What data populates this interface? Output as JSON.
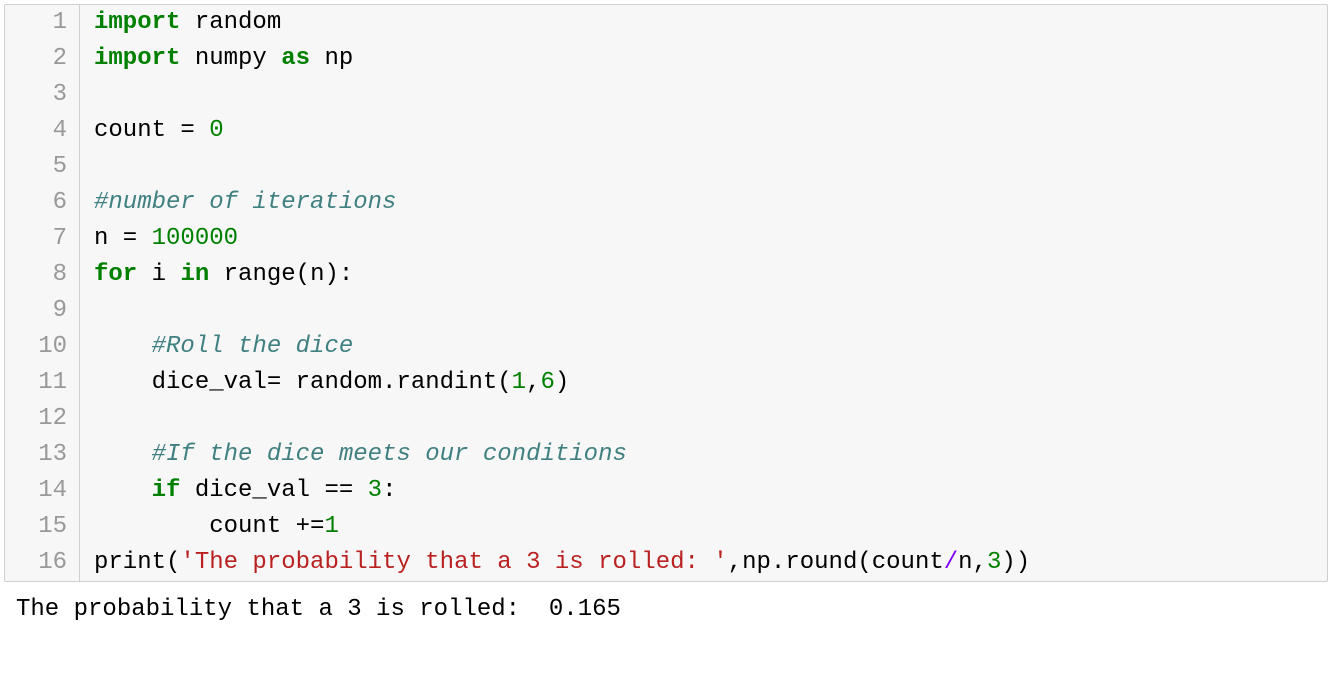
{
  "gutter": [
    "1",
    "2",
    "3",
    "4",
    "5",
    "6",
    "7",
    "8",
    "9",
    "10",
    "11",
    "12",
    "13",
    "14",
    "15",
    "16"
  ],
  "lines": {
    "l1": {
      "kw1": "import",
      "rest": " random"
    },
    "l2": {
      "kw1": "import",
      "mid": " numpy ",
      "kw2": "as",
      "rest": " np"
    },
    "l3": {
      "txt": ""
    },
    "l4": {
      "pre": "count = ",
      "num": "0"
    },
    "l5": {
      "txt": ""
    },
    "l6": {
      "cmt": "#number of iterations"
    },
    "l7": {
      "pre": "n = ",
      "num": "100000"
    },
    "l8": {
      "kw1": "for",
      "mid1": " i ",
      "kw2": "in",
      "mid2": " range(n):"
    },
    "l9": {
      "txt": ""
    },
    "l10": {
      "indent": "    ",
      "cmt": "#Roll the dice"
    },
    "l11": {
      "indent": "    ",
      "pre": "dice_val= random.randint(",
      "num1": "1",
      "comma": ",",
      "num2": "6",
      "end": ")"
    },
    "l12": {
      "txt": ""
    },
    "l13": {
      "indent": "    ",
      "cmt": "#If the dice meets our conditions"
    },
    "l14": {
      "indent": "    ",
      "kw1": "if",
      "mid": " dice_val == ",
      "num": "3",
      "end": ":"
    },
    "l15": {
      "indent": "        ",
      "pre": "count +=",
      "num": "1"
    },
    "l16": {
      "pre": "print(",
      "str": "'The probability that a 3 is rolled: '",
      "mid": ",np.round(count",
      "slash": "/",
      "post": "n,",
      "num": "3",
      "end": "))"
    }
  },
  "output": "The probability that a 3 is rolled:  0.165"
}
